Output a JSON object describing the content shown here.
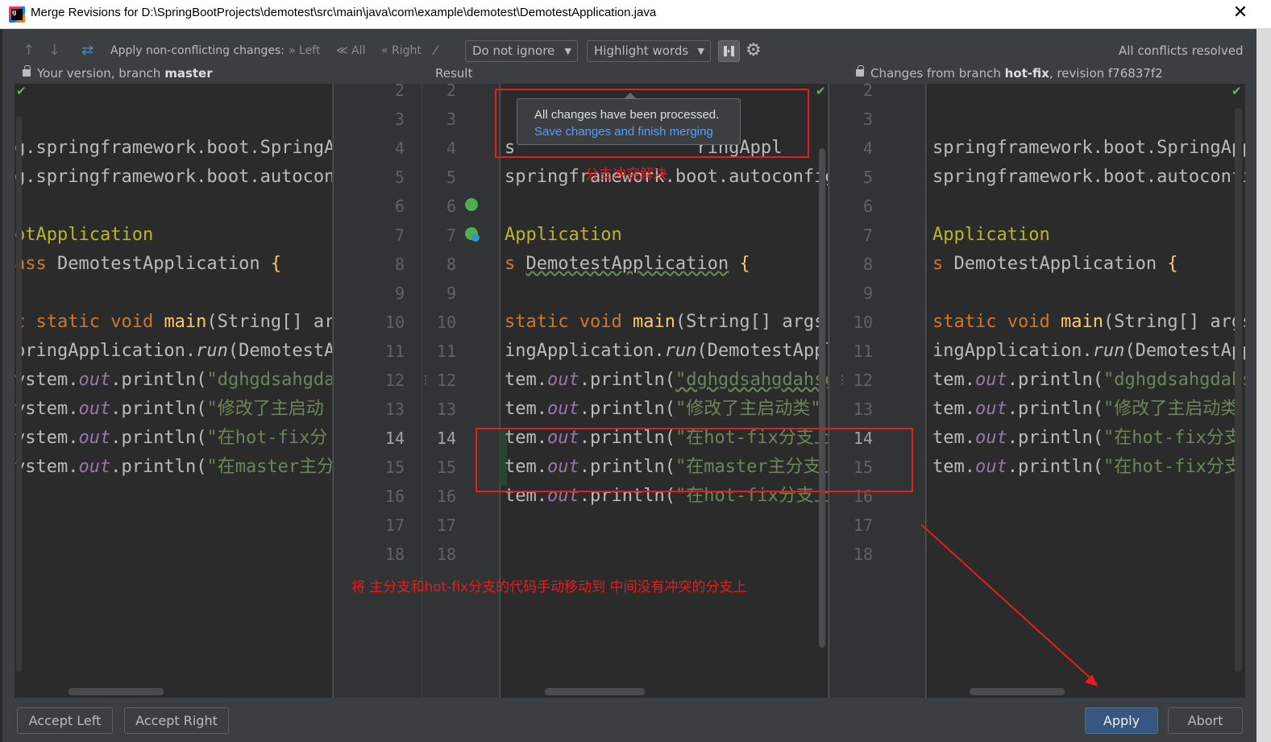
{
  "window": {
    "title": "Merge Revisions for D:\\SpringBootProjects\\demotest\\src\\main\\java\\com\\example\\demotest\\DemotestApplication.java",
    "close": "✕"
  },
  "toolbar": {
    "apply_label": "Apply non-conflicting changes:",
    "left": "Left",
    "all": "All",
    "right": "Right",
    "ignore_select": "Do not ignore",
    "highlight_select": "Highlight words",
    "status": "All conflicts resolved"
  },
  "headers": {
    "left_prefix": "Your version, branch",
    "left_branch": "master",
    "center": "Result",
    "right_prefix": "Changes from branch",
    "right_branch": "hot-fix",
    "right_suffix": ", revision f76837f2"
  },
  "left_pane": {
    "lines": [
      "",
      "g.springframework.boot.SpringAp",
      "g.springframework.boot.autocon",
      "",
      "otApplication",
      "ass DemotestApplication {",
      "",
      "c static void main(String[] arg",
      "pringApplication.run(DemotestAp",
      "ystem.out.println(\"dghgdsahgdal",
      "ystem.out.println(\"修改了主启动",
      "ystem.out.println(\"在hot-fix分",
      "ystem.out.println(\"在master主分"
    ]
  },
  "center_pane": {
    "lines": [
      "",
      "s                 ringAppl",
      "springframework.boot.autoconfig",
      "",
      "Application",
      "s DemotestApplication {",
      "",
      "static void main(String[] args)",
      "ingApplication.run(DemotestAppl",
      "tem.out.println(\"dghgdsahgdahsg",
      "tem.out.println(\"修改了主启动类\"",
      "tem.out.println(\"在hot-fix分支上",
      "tem.out.println(\"在master主分支上",
      "tem.out.println(\"在hot-fix分支上"
    ]
  },
  "right_pane": {
    "lines": [
      "",
      "springframework.boot.SpringApp",
      "springframework.boot.autoconfi",
      "",
      "Application",
      "s DemotestApplication {",
      "",
      "static void main(String[] args",
      "ingApplication.run(DemotestApp",
      "tem.out.println(\"dghgdsahgdahs",
      "tem.out.println(\"修改了主启动类",
      "tem.out.println(\"在hot-fix分支.",
      "tem.out.println(\"在hot-fix分支"
    ]
  },
  "gutter": {
    "left_numbers": [
      "2",
      "3",
      "4",
      "5",
      "6",
      "7",
      "8",
      "9",
      "10",
      "11",
      "12",
      "13",
      "14",
      "15",
      "16",
      "17",
      "18"
    ],
    "center_numbers": [
      "2",
      "3",
      "4",
      "5",
      "6",
      "7",
      "8",
      "9",
      "10",
      "11",
      "12",
      "13",
      "14",
      "15",
      "16",
      "17",
      "18"
    ],
    "right_numbers": [
      "2",
      "3",
      "4",
      "5",
      "6",
      "7",
      "8",
      "9",
      "10",
      "11",
      "12",
      "13",
      "14",
      "15",
      "16",
      "17",
      "18"
    ],
    "current_line": "14"
  },
  "tooltip": {
    "message": "All changes have been processed.",
    "link": "Save changes and finish merging"
  },
  "annotations": {
    "conflict_resolved": "分支冲突解决",
    "instruction": "将  主分支和hot-fix分支的代码手动移动到   中间没有冲突的分支上"
  },
  "buttons": {
    "accept_left": "Accept Left",
    "accept_right": "Accept Right",
    "apply": "Apply",
    "abort": "Abort"
  },
  "colors": {
    "background": "#2b2b2b",
    "panel": "#3c3f41",
    "keyword": "#cc7832",
    "string": "#6a8759",
    "field": "#9876aa",
    "method": "#ffc66d",
    "annotation_red": "#e11f1f",
    "primary_button": "#365880"
  }
}
